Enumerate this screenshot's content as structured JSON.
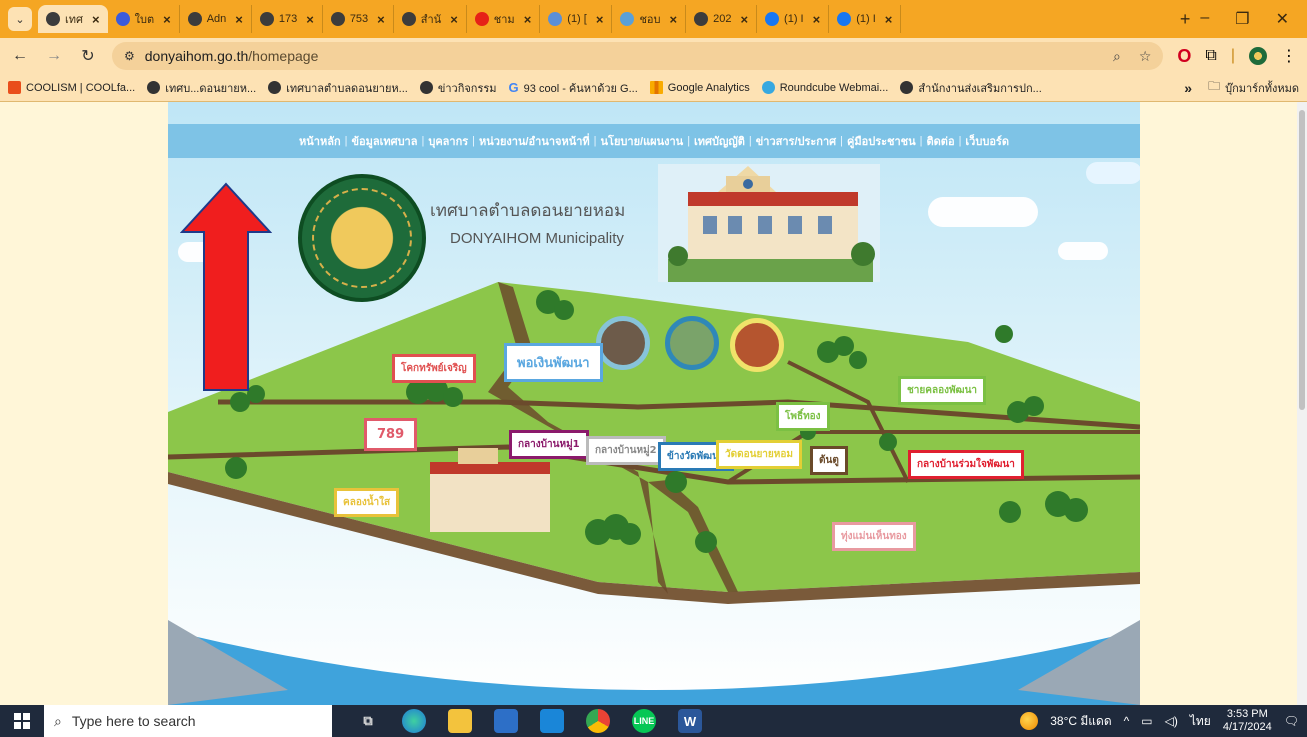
{
  "browser": {
    "tabs": [
      {
        "label": "เทศ",
        "favicon": "globe-icon",
        "color": "#3c3c3c",
        "active": true
      },
      {
        "label": "ใบต",
        "favicon": "sheet-icon",
        "color": "#3b5bdb"
      },
      {
        "label": "Adn",
        "favicon": "globe-icon",
        "color": "#3c3c3c"
      },
      {
        "label": "173",
        "favicon": "globe-icon",
        "color": "#3c3c3c"
      },
      {
        "label": "753",
        "favicon": "globe-icon",
        "color": "#3c3c3c"
      },
      {
        "label": "สำนั",
        "favicon": "globe-icon",
        "color": "#3c3c3c"
      },
      {
        "label": "ชาม",
        "favicon": "youtube-icon",
        "color": "#e62117"
      },
      {
        "label": "(1) [",
        "favicon": "mail-icon",
        "color": "#5c8fd6"
      },
      {
        "label": "ชอบ",
        "favicon": "globe-icon",
        "color": "#5aa0d8"
      },
      {
        "label": "202",
        "favicon": "globe-icon",
        "color": "#3c3c3c"
      },
      {
        "label": "(1) I",
        "favicon": "facebook-icon",
        "color": "#1877f2"
      },
      {
        "label": "(1) I",
        "favicon": "facebook-icon",
        "color": "#1877f2"
      }
    ],
    "new_tab": "+",
    "window_controls": {
      "minimize": "–",
      "restore": "❐",
      "close": "✕"
    },
    "url_host": "donyaihom.go.th",
    "url_path": "/homepage",
    "bookmarks": [
      {
        "label": "COOLISM | COOLfa...",
        "icon": "red"
      },
      {
        "label": "เทศบ...ดอนยายห...",
        "icon": "globe"
      },
      {
        "label": "เทศบาลตำบลดอนยายห...",
        "icon": "globe"
      },
      {
        "label": "ข่าวกิจกรรม",
        "icon": "globe"
      },
      {
        "label": "93 cool - ค้นหาด้วย G...",
        "icon": "google"
      },
      {
        "label": "Google Analytics",
        "icon": "analytics"
      },
      {
        "label": "Roundcube Webmai...",
        "icon": "roundcube"
      },
      {
        "label": "สำนักงานส่งเสริมการปก...",
        "icon": "globe"
      }
    ],
    "bookmarks_more": "»",
    "bookmarks_folder": "บุ๊กมาร์กทั้งหมด"
  },
  "site": {
    "nav": [
      "หน้าหลัก",
      "ข้อมูลเทศบาล",
      "บุคลากร",
      "หน่วยงาน/อำนาจหน้าที่",
      "นโยบาย/แผนงาน",
      "เทศบัญญัติ",
      "ข่าวสาร/ประกาศ",
      "คู่มือประชาชน",
      "ติดต่อ",
      "เว็บบอร์ด"
    ],
    "title_th": "เทศบาลตำบลดอนยายหอม",
    "title_en": "DONYAIHOM Municipality",
    "signs": [
      {
        "label": "โคกทรัพย์เจริญ",
        "color": "#e05050"
      },
      {
        "label": "พอเงินพัฒนา",
        "color": "#5aa7e0"
      },
      {
        "label": "789",
        "color": "#e05a6a"
      },
      {
        "label": "กลางบ้านหมู่1",
        "color": "#8b1a6b"
      },
      {
        "label": "กลางบ้านหมู่2",
        "color": "#bbbbbb"
      },
      {
        "label": "ข้างวัดพัฒนา",
        "color": "#2a7ab5"
      },
      {
        "label": "วัดดอนยายหอม",
        "color": "#e3cf35"
      },
      {
        "label": "โพธิ์ทอง",
        "color": "#7bc043"
      },
      {
        "label": "ต้นตู",
        "color": "#6a4a2a"
      },
      {
        "label": "ชายคลองพัฒนา",
        "color": "#7bc043"
      },
      {
        "label": "กลางบ้านร่วมใจพัฒนา",
        "color": "#e02030"
      },
      {
        "label": "คลองน้ำใส",
        "color": "#e8c23a"
      },
      {
        "label": "ทุ่งแม่นเห็นทอง",
        "color": "#e89aa0"
      }
    ]
  },
  "taskbar": {
    "search_placeholder": "Type here to search",
    "weather": "38°C มีแดด",
    "lang": "ไทย",
    "time": "3:53 PM",
    "date": "4/17/2024"
  }
}
